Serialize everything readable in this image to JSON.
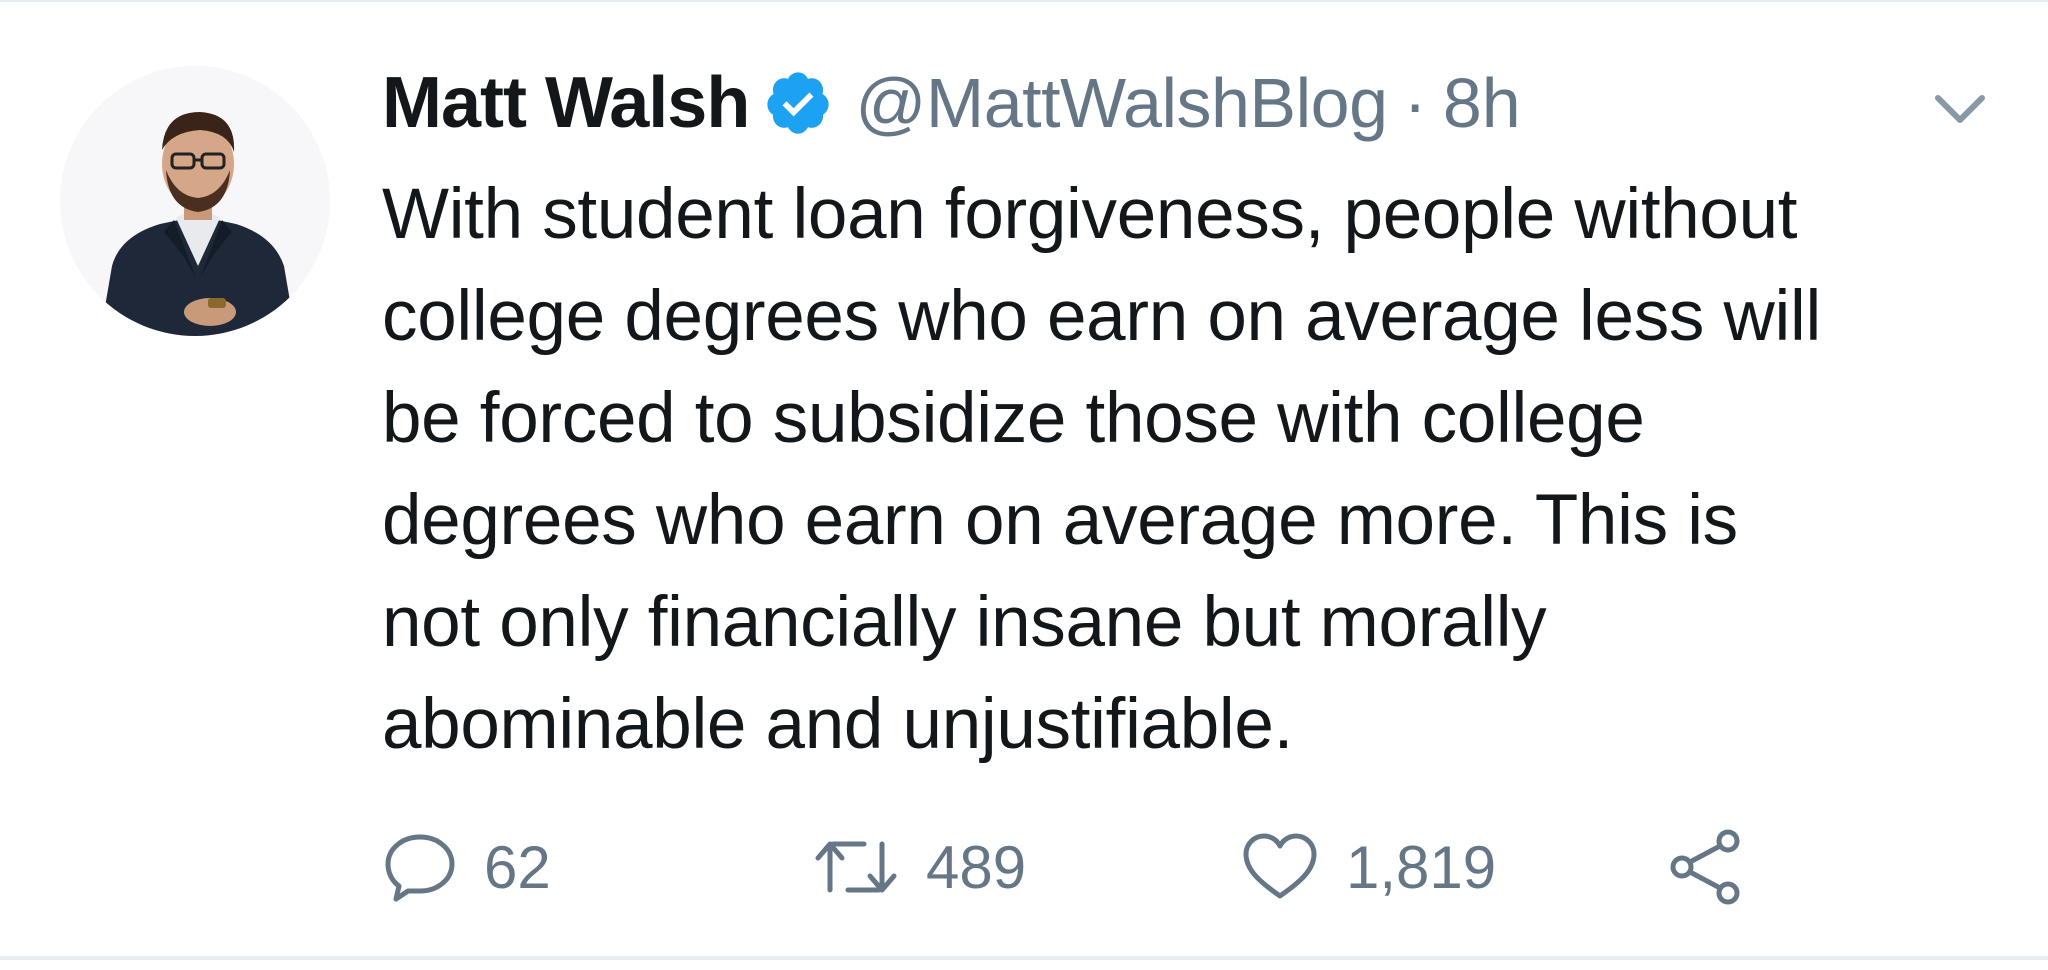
{
  "tweet": {
    "author_name": "Matt Walsh",
    "handle": "@MattWalshBlog",
    "separator": "·",
    "time": "8h",
    "verified": true,
    "text_lines": [
      "With student loan forgiveness, people without",
      "college degrees who earn on average less will",
      "be forced to subsidize those with college",
      "degrees who earn on average more. This is",
      "not only financially insane but morally",
      "abominable and unjustifiable."
    ],
    "actions": {
      "reply_count": "62",
      "retweet_count": "489",
      "like_count": "1,819"
    }
  },
  "icons": {
    "verified": "verified-badge-icon",
    "caret": "chevron-down-icon",
    "reply": "reply-bubble-icon",
    "retweet": "retweet-icon",
    "like": "heart-icon",
    "share": "share-icon"
  },
  "colors": {
    "text_primary": "#14171a",
    "text_secondary": "#657786",
    "verified_blue": "#1da1f2",
    "divider": "#e6ecf0"
  }
}
